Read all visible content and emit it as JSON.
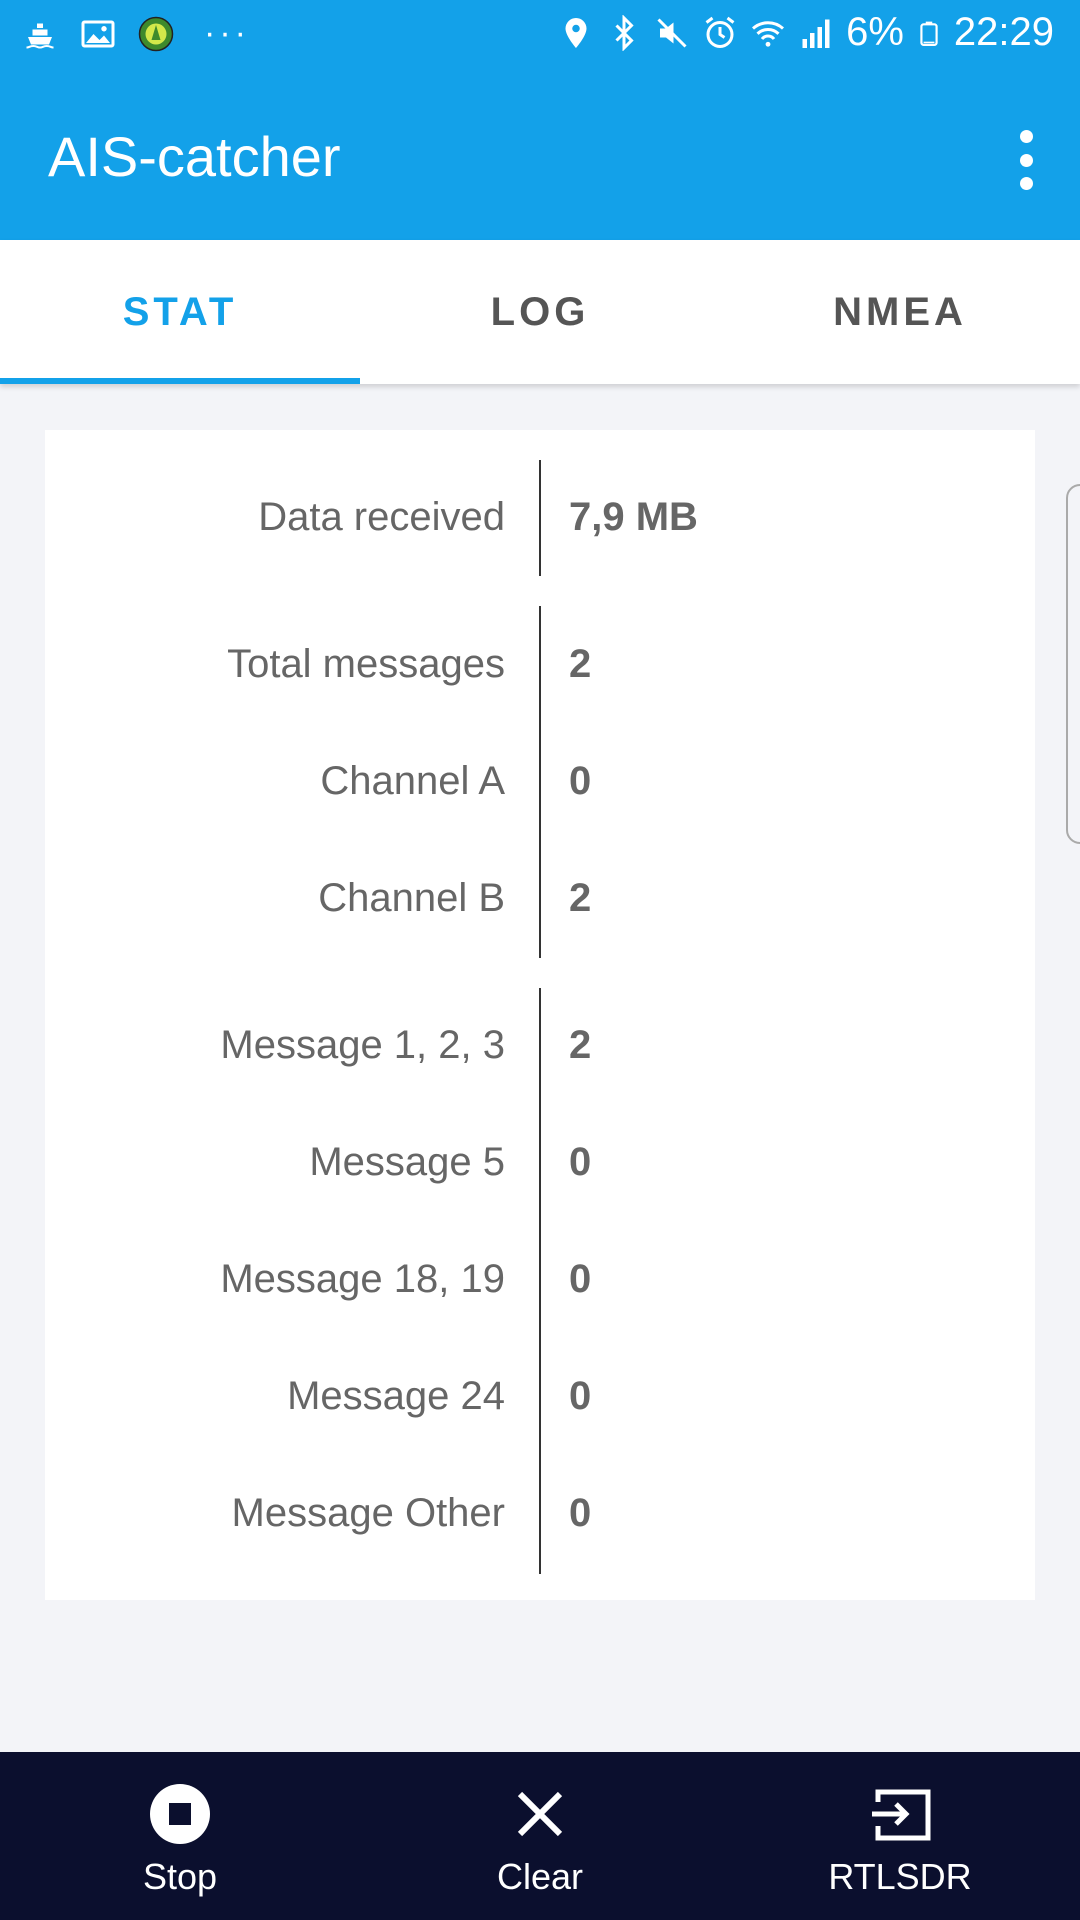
{
  "status_bar": {
    "icons_left": [
      "ship-icon",
      "image-icon",
      "app-badge-icon"
    ],
    "more": "···",
    "icons_right": [
      "location-icon",
      "bluetooth-icon",
      "mute-icon",
      "alarm-icon",
      "wifi-icon",
      "signal-icon"
    ],
    "battery": "6%",
    "time": "22:29"
  },
  "app_bar": {
    "title": "AIS-catcher"
  },
  "tabs": [
    {
      "label": "STAT",
      "active": true
    },
    {
      "label": "LOG",
      "active": false
    },
    {
      "label": "NMEA",
      "active": false
    }
  ],
  "stats": {
    "data_received": {
      "label": "Data received",
      "value": "7,9 MB"
    },
    "total_messages": {
      "label": "Total messages",
      "value": "2"
    },
    "channel_a": {
      "label": "Channel A",
      "value": "0"
    },
    "channel_b": {
      "label": "Channel B",
      "value": "2"
    },
    "message_123": {
      "label": "Message 1, 2, 3",
      "value": "2"
    },
    "message_5": {
      "label": "Message 5",
      "value": "0"
    },
    "message_18_19": {
      "label": "Message 18, 19",
      "value": "0"
    },
    "message_24": {
      "label": "Message 24",
      "value": "0"
    },
    "message_other": {
      "label": "Message Other",
      "value": "0"
    }
  },
  "bottom_bar": {
    "stop": "Stop",
    "clear": "Clear",
    "rtlsdr": "RTLSDR"
  },
  "colors": {
    "primary": "#13a1e9",
    "bottom_bar": "#0b0f2e",
    "background": "#f3f4f8"
  }
}
